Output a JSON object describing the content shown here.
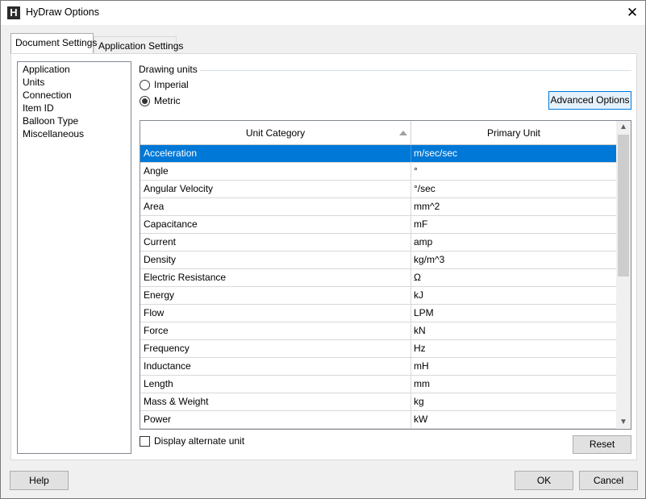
{
  "window": {
    "title": "HyDraw Options",
    "app_icon_letter": "H"
  },
  "tabs": [
    {
      "label": "Document Settings",
      "active": true
    },
    {
      "label": "Application Settings",
      "active": false
    }
  ],
  "sidebar": {
    "items": [
      {
        "label": "Application"
      },
      {
        "label": "Units"
      },
      {
        "label": "Connection"
      },
      {
        "label": "Item ID"
      },
      {
        "label": "Balloon Type"
      },
      {
        "label": "Miscellaneous"
      }
    ]
  },
  "drawing_units": {
    "group_label": "Drawing units",
    "options": [
      {
        "label": "Imperial",
        "checked": false
      },
      {
        "label": "Metric",
        "checked": true
      }
    ],
    "advanced_button": "Advanced Options"
  },
  "grid": {
    "columns": [
      "Unit Category",
      "Primary Unit"
    ],
    "sorted_column": "Unit Category",
    "rows": [
      {
        "category": "Acceleration",
        "unit": "m/sec/sec",
        "selected": true
      },
      {
        "category": "Angle",
        "unit": "°"
      },
      {
        "category": "Angular Velocity",
        "unit": "°/sec"
      },
      {
        "category": "Area",
        "unit": "mm^2"
      },
      {
        "category": "Capacitance",
        "unit": "mF"
      },
      {
        "category": "Current",
        "unit": "amp"
      },
      {
        "category": "Density",
        "unit": "kg/m^3"
      },
      {
        "category": "Electric Resistance",
        "unit": "Ω"
      },
      {
        "category": "Energy",
        "unit": "kJ"
      },
      {
        "category": "Flow",
        "unit": "LPM"
      },
      {
        "category": "Force",
        "unit": "kN"
      },
      {
        "category": "Frequency",
        "unit": "Hz"
      },
      {
        "category": "Inductance",
        "unit": "mH"
      },
      {
        "category": "Length",
        "unit": "mm"
      },
      {
        "category": "Mass & Weight",
        "unit": "kg"
      },
      {
        "category": "Power",
        "unit": "kW"
      }
    ]
  },
  "display_alternate_unit": {
    "label": "Display alternate unit",
    "checked": false
  },
  "buttons": {
    "reset": "Reset",
    "help": "Help",
    "ok": "OK",
    "cancel": "Cancel"
  },
  "colors": {
    "selection": "#0078d7",
    "accent_border": "#0078d7"
  }
}
